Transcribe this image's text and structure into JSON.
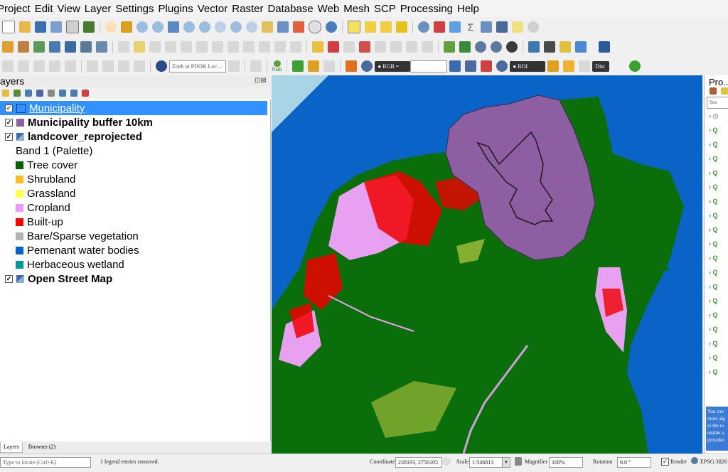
{
  "menu": [
    "Project",
    "Edit",
    "View",
    "Layer",
    "Settings",
    "Plugins",
    "Vector",
    "Raster",
    "Database",
    "Web",
    "Mesh",
    "SCP",
    "Processing",
    "Help"
  ],
  "toolbar": {
    "pdok_placeholder": "Zoek in PDOK Loc…",
    "rgb_label": "RGB =",
    "roi_label": "ROI",
    "dist_label": "Dist",
    "hub_label": "hub"
  },
  "layers_panel": {
    "title": "ayers",
    "items": [
      {
        "label": "Municipality",
        "checked": true,
        "color": "#0a64c8",
        "selected": true
      },
      {
        "label": "Municipality buffer 10km",
        "checked": true,
        "color": "#8e5ea2"
      },
      {
        "label": "landcover_reprojected",
        "checked": true,
        "color": "raster-icon"
      }
    ],
    "band_label": "Band 1 (Palette)",
    "legend": [
      {
        "label": "Tree cover",
        "color": "#006400"
      },
      {
        "label": "Shrubland",
        "color": "#ffbb22"
      },
      {
        "label": "Grassland",
        "color": "#ffff4c"
      },
      {
        "label": "Cropland",
        "color": "#f096ff"
      },
      {
        "label": "Built-up",
        "color": "#fa0000"
      },
      {
        "label": "Bare/Sparse vegetation",
        "color": "#b4b4b4"
      },
      {
        "label": "Pemenant water bodies",
        "color": "#0064c8"
      },
      {
        "label": "Herbaceous wetland",
        "color": "#0096a0"
      }
    ],
    "osm_label": "Open Street Map",
    "tabs": [
      "Layers",
      "Browser (2)"
    ]
  },
  "right_panel": {
    "title": "Pro..",
    "search_placeholder": "Sea",
    "info_text": "You can more alg to the to enable a provider"
  },
  "status": {
    "locate_placeholder": "Type to locate (Ctrl+K)",
    "message": "1 legend entries removed.",
    "coordinate_label": "Coordinate",
    "coordinate_value": "238193, 2756105",
    "scale_label": "Scale",
    "scale_value": "1:546813",
    "magnifier_label": "Magnifier",
    "magnifier_value": "100%",
    "rotation_label": "Rotation",
    "rotation_value": "0.0 °",
    "render_label": "Render",
    "crs_label": "EPSG:3826"
  }
}
